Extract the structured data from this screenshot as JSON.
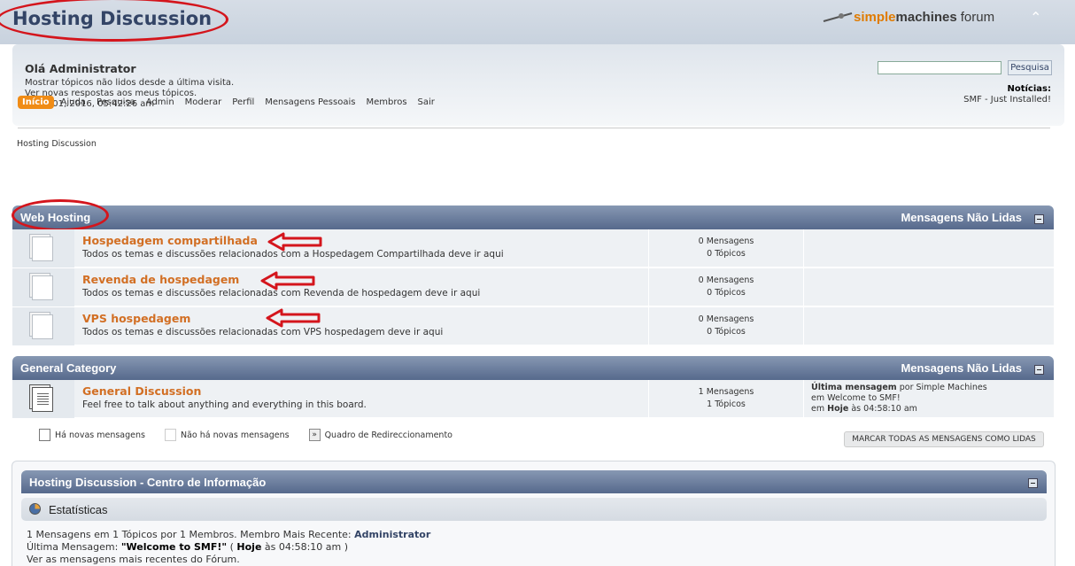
{
  "header": {
    "forum_title": "Hosting Discussion",
    "logo_simple": "simple",
    "logo_machines": "machines",
    "logo_forum": "forum"
  },
  "user": {
    "greeting": "Olá Administrator",
    "link_unread": "Mostrar tópicos não lidos desde a última visita.",
    "link_replies": "Ver novas respostas aos meus tópicos.",
    "date": "Junho 01, 2016, 05:42:26 am"
  },
  "search": {
    "value": "",
    "button": "Pesquisa"
  },
  "news": {
    "title": "Notícias:",
    "text": "SMF - Just Installed!"
  },
  "menu": [
    "Início",
    "Ajuda",
    "Pesquisa",
    "Admin",
    "Moderar",
    "Perfil",
    "Mensagens Pessoais",
    "Membros",
    "Sair"
  ],
  "breadcrumb": "Hosting Discussion",
  "categories": [
    {
      "name": "Web Hosting",
      "unread": "Mensagens Não Lidas",
      "boards": [
        {
          "name": "Hospedagem compartilhada",
          "desc": "Todos os temas e discussões relacionados com a Hospedagem Compartilhada deve ir aqui",
          "posts": "0 Mensagens",
          "topics": "0 Tópicos"
        },
        {
          "name": "Revenda de hospedagem",
          "desc": "Todos os temas e discussões relacionadas com Revenda de hospedagem deve ir aqui",
          "posts": "0 Mensagens",
          "topics": "0 Tópicos"
        },
        {
          "name": "VPS hospedagem",
          "desc": "Todos os temas e discussões relacionadas com VPS hospedagem deve ir aqui",
          "posts": "0 Mensagens",
          "topics": "0 Tópicos"
        }
      ]
    },
    {
      "name": "General Category",
      "unread": "Mensagens Não Lidas",
      "boards": [
        {
          "name": "General Discussion",
          "desc": "Feel free to talk about anything and everything in this board.",
          "posts": "1 Mensagens",
          "topics": "1 Tópicos",
          "last_label": "Última mensagem",
          "last_by": "por Simple Machines",
          "last_in": "em Welcome to SMF!",
          "last_when_prefix": "em",
          "last_when_day": "Hoje",
          "last_when_time": "às 04:58:10 am"
        }
      ]
    }
  ],
  "legend": {
    "new": "Há novas mensagens",
    "none": "Não há novas mensagens",
    "redirect": "Quadro de Redireccionamento"
  },
  "mark_all": "MARCAR TODAS AS MENSAGENS COMO LIDAS",
  "info_center": {
    "title": "Hosting Discussion - Centro de Informação",
    "stats_title": "Estatísticas",
    "line1_prefix": "1 Mensagens em 1 Tópicos por 1 Membros. Membro Mais Recente:",
    "line1_member": "Administrator",
    "line2_prefix": "Última Mensagem:",
    "line2_topic": "\"Welcome to SMF!\"",
    "line2_open": "(",
    "line2_day": "Hoje",
    "line2_time": "às 04:58:10 am )",
    "line3": "Ver as mensagens mais recentes do Fórum."
  }
}
